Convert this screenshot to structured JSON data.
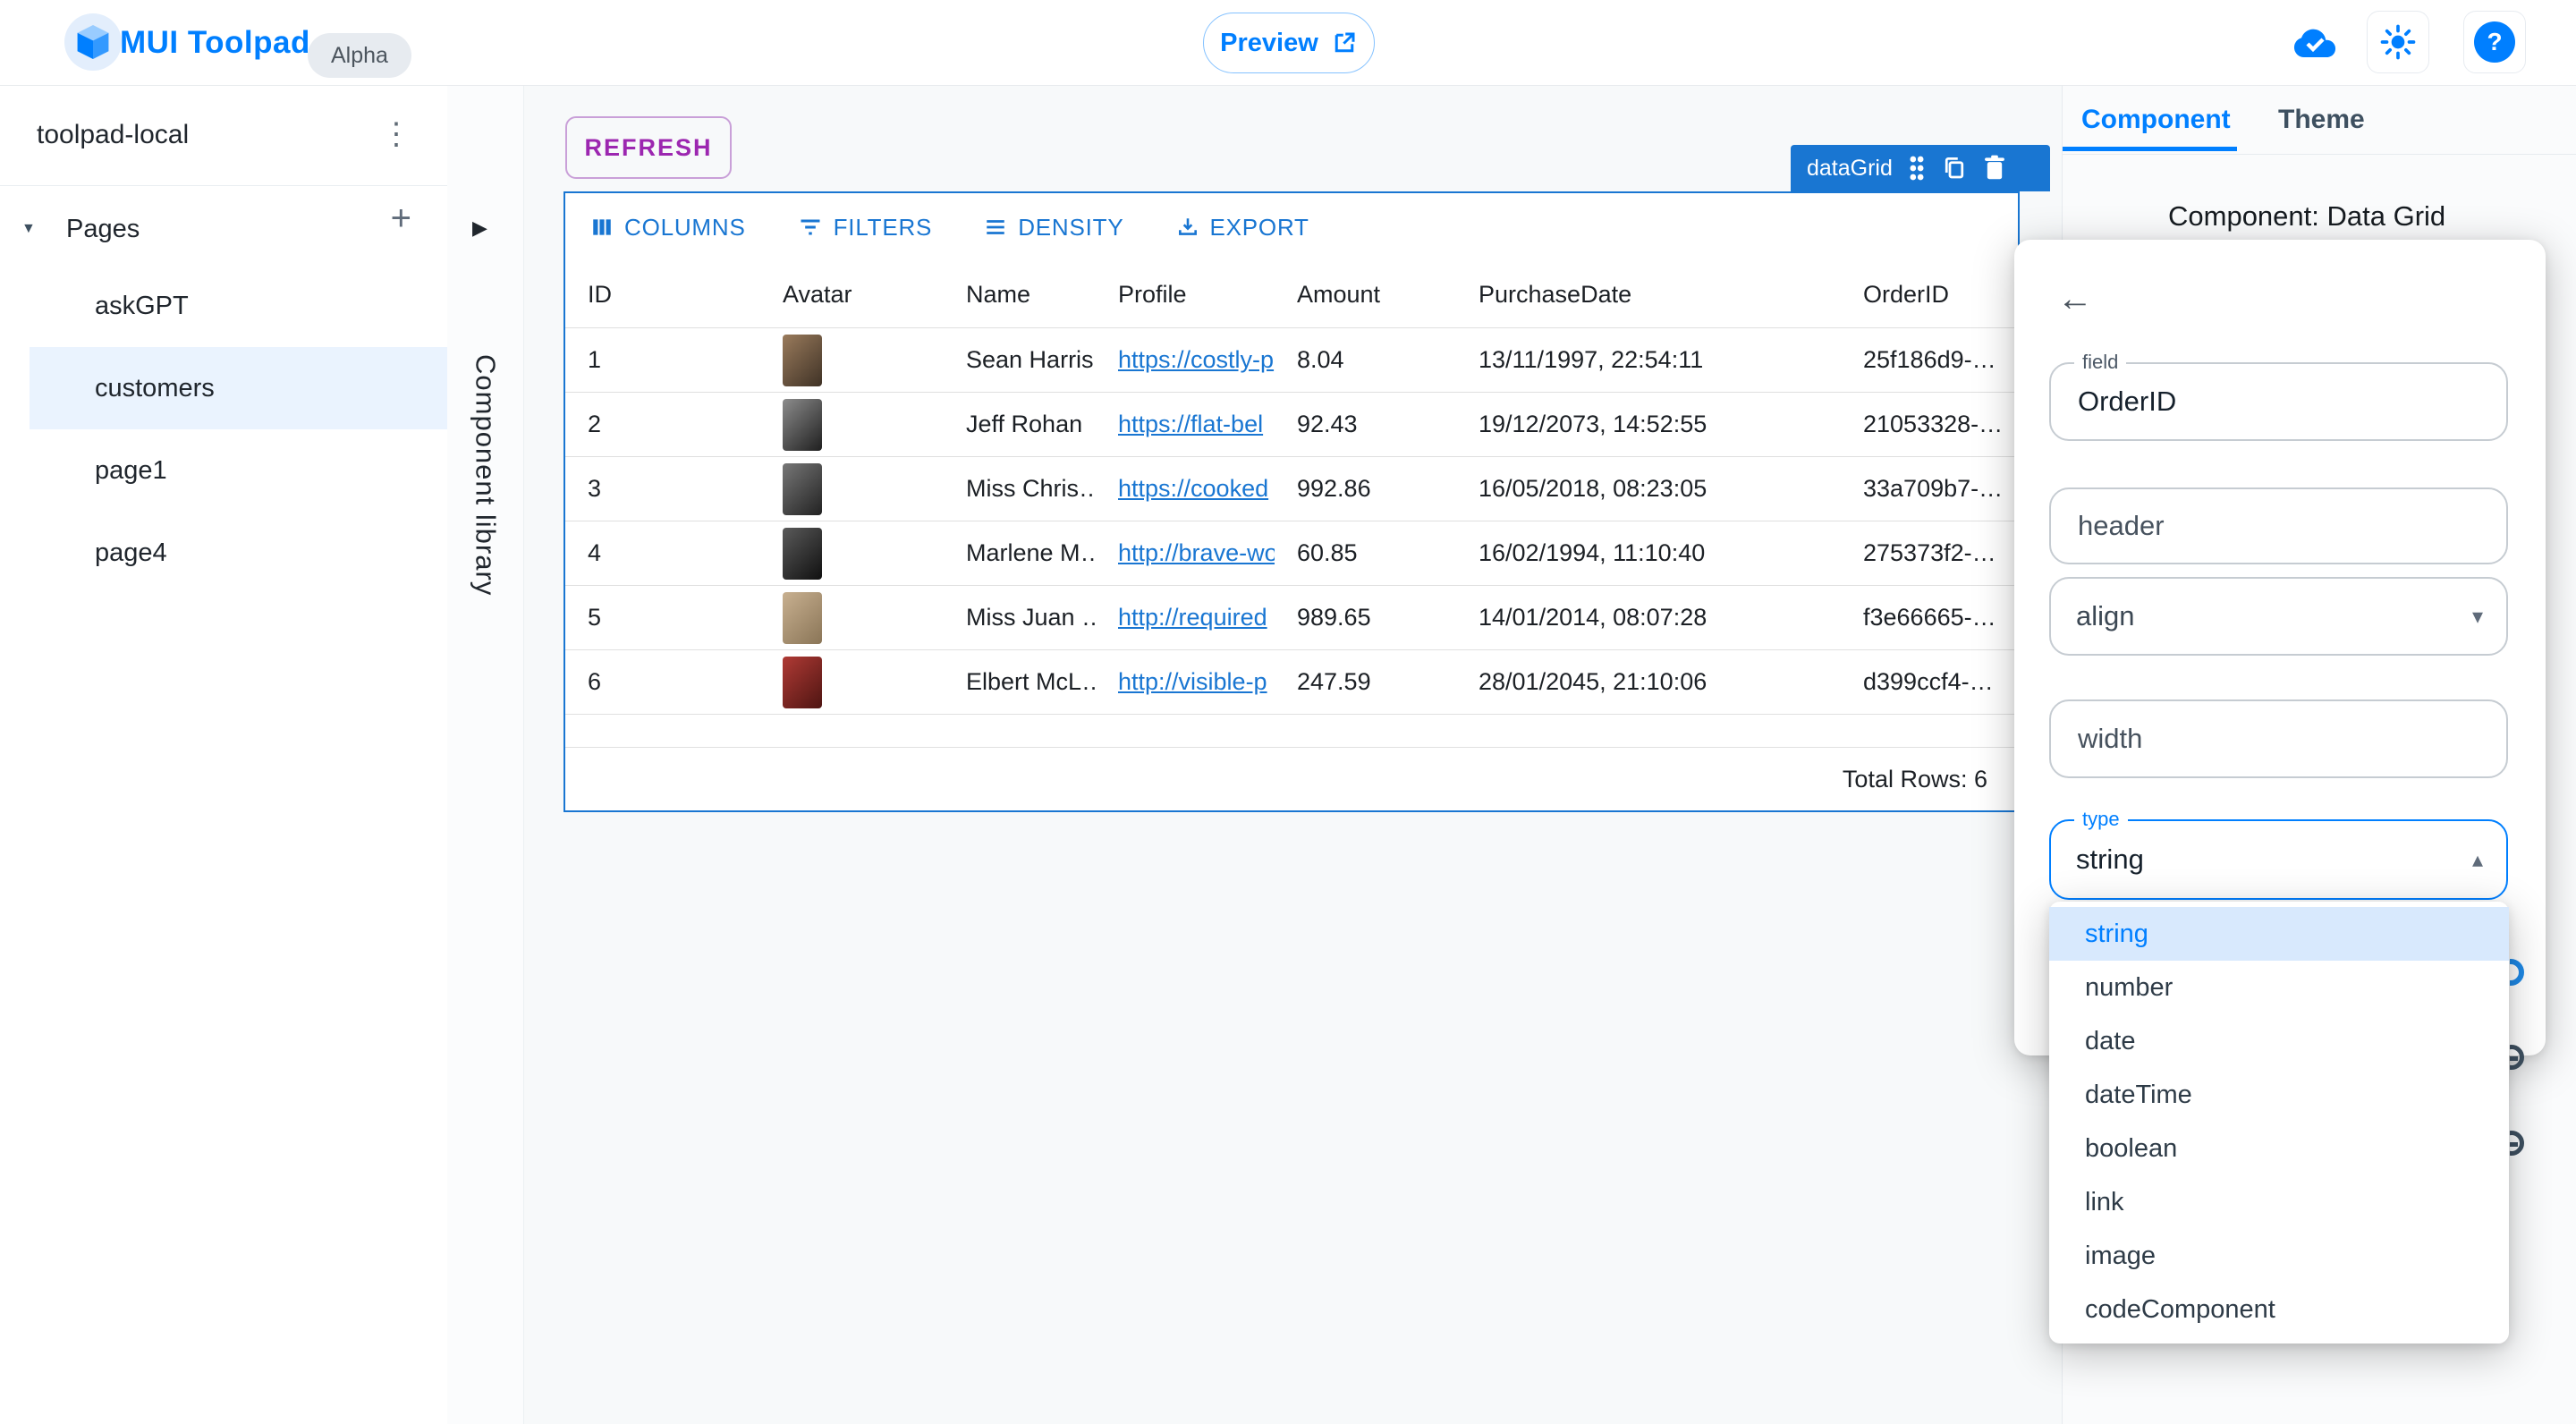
{
  "topbar": {
    "brand": "MUI Toolpad",
    "badge": "Alpha",
    "preview_label": "Preview"
  },
  "sidebar": {
    "project": "toolpad-local",
    "section_label": "Pages",
    "pages": [
      "askGPT",
      "customers",
      "page1",
      "page4"
    ],
    "selected_page": "customers"
  },
  "library": {
    "label": "Component library"
  },
  "canvas": {
    "refresh_label": "REFRESH",
    "selection_chip": "dataGrid"
  },
  "grid": {
    "toolbar": [
      {
        "icon": "columns-icon",
        "label": "COLUMNS"
      },
      {
        "icon": "filters-icon",
        "label": "FILTERS"
      },
      {
        "icon": "density-icon",
        "label": "DENSITY"
      },
      {
        "icon": "export-icon",
        "label": "EXPORT"
      }
    ],
    "columns": [
      "ID",
      "Avatar",
      "Name",
      "Profile",
      "Amount",
      "PurchaseDate",
      "OrderID"
    ],
    "rows": [
      {
        "id": "1",
        "name": "Sean Harris",
        "profile": "https://costly-p",
        "amount": "8.04",
        "purchase_date": "13/11/1997, 22:54:11",
        "order_id": "25f186d9-…",
        "avatar_colors": [
          "#9a7b5c",
          "#3f3226"
        ]
      },
      {
        "id": "2",
        "name": "Jeff Rohan",
        "profile": "https://flat-bel",
        "amount": "92.43",
        "purchase_date": "19/12/2073, 14:52:55",
        "order_id": "21053328-…",
        "avatar_colors": [
          "#8c8c8c",
          "#1f1f1f"
        ]
      },
      {
        "id": "3",
        "name": "Miss Chris…",
        "profile": "https://cooked",
        "amount": "992.86",
        "purchase_date": "16/05/2018, 08:23:05",
        "order_id": "33a709b7-…",
        "avatar_colors": [
          "#777777",
          "#222222"
        ]
      },
      {
        "id": "4",
        "name": "Marlene M…",
        "profile": "http://brave-wo",
        "amount": "60.85",
        "purchase_date": "16/02/1994, 11:10:40",
        "order_id": "275373f2-…",
        "avatar_colors": [
          "#5a5a5a",
          "#101010"
        ]
      },
      {
        "id": "5",
        "name": "Miss Juan …",
        "profile": "http://required",
        "amount": "989.65",
        "purchase_date": "14/01/2014, 08:07:28",
        "order_id": "f3e66665-…",
        "avatar_colors": [
          "#c8b090",
          "#8a7557"
        ]
      },
      {
        "id": "6",
        "name": "Elbert McL…",
        "profile": "http://visible-p",
        "amount": "247.59",
        "purchase_date": "28/01/2045, 21:10:06",
        "order_id": "d399ccf4-…",
        "avatar_colors": [
          "#b03a35",
          "#4e1512"
        ]
      }
    ],
    "footer": "Total Rows: 6"
  },
  "inspector": {
    "tabs": [
      "Component",
      "Theme"
    ],
    "active_tab": "Component",
    "title": "Component: Data Grid"
  },
  "editor": {
    "field_label": "field",
    "field_value": "OrderID",
    "header_placeholder": "header",
    "align_value": "align",
    "width_placeholder": "width",
    "type_label": "type",
    "type_value": "string"
  },
  "type_menu": {
    "items": [
      "string",
      "number",
      "date",
      "dateTime",
      "boolean",
      "link",
      "image",
      "codeComponent"
    ],
    "selected": "string"
  },
  "colors": {
    "brand_blue": "#007fff",
    "grid_blue": "#1976d2",
    "secondary_purple": "#9c27b0",
    "selected_row_bg": "#eaf3fe",
    "menu_highlight": "#d8e9fd"
  }
}
